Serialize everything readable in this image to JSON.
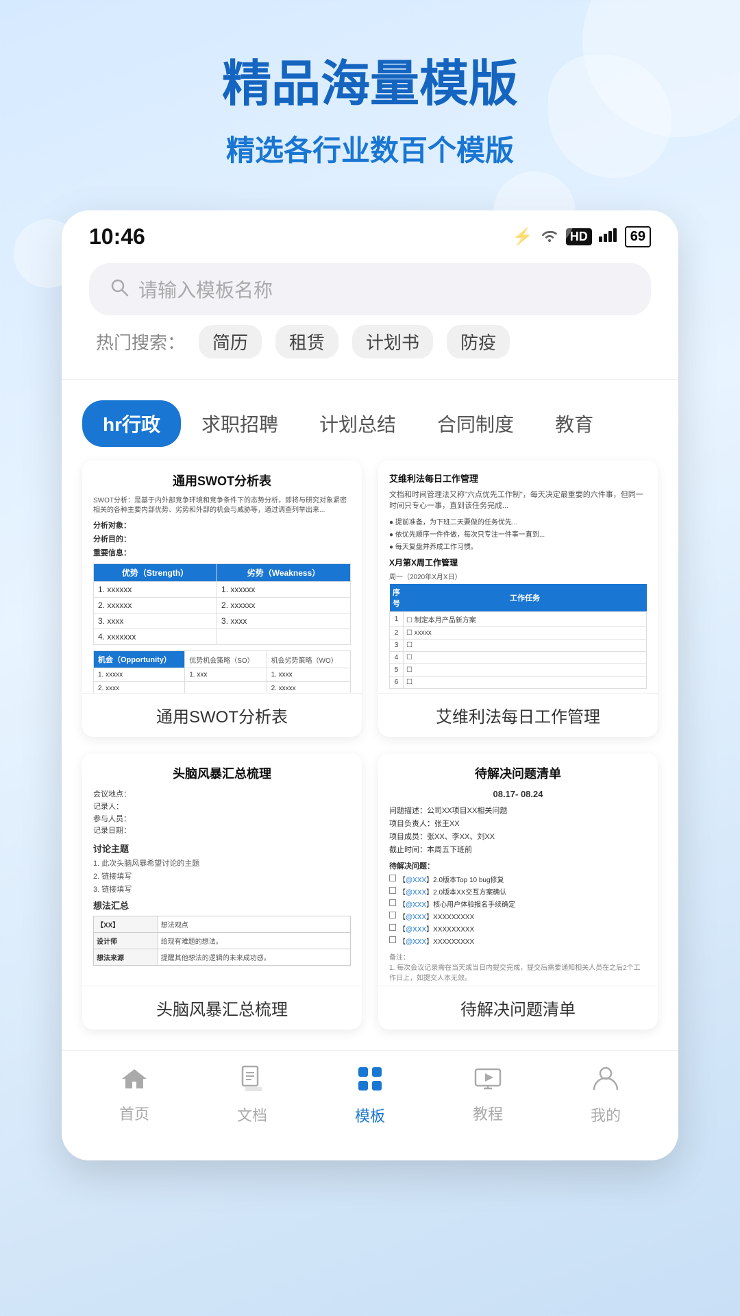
{
  "hero": {
    "title": "精品海量模版",
    "subtitle": "精选各行业数百个模版"
  },
  "statusBar": {
    "time": "10:46",
    "icons": [
      "bluetooth",
      "wifi",
      "hd",
      "signal",
      "battery"
    ],
    "batteryLevel": "69"
  },
  "search": {
    "placeholder": "请输入模板名称",
    "hotLabel": "热门搜索：",
    "hotTags": [
      "简历",
      "租赁",
      "计划书",
      "防疫"
    ]
  },
  "categories": [
    {
      "id": "hr",
      "label": "hr行政",
      "active": true
    },
    {
      "id": "job",
      "label": "求职招聘",
      "active": false
    },
    {
      "id": "plan",
      "label": "计划总结",
      "active": false
    },
    {
      "id": "contract",
      "label": "合同制度",
      "active": false
    },
    {
      "id": "edu",
      "label": "教育",
      "active": false
    }
  ],
  "templates": [
    {
      "id": "swot",
      "title": "通用SWOT分析表",
      "label": "通用SWOT分析表"
    },
    {
      "id": "workmanage",
      "title": "艾维利法每日工作管理",
      "label": "艾维利法每日工作管理"
    },
    {
      "id": "brainstorm",
      "title": "头脑风暴汇总梳理",
      "label": "头脑风暴汇总梳理"
    },
    {
      "id": "problem",
      "title": "待解决问题清单",
      "label": "待解决问题清单"
    }
  ],
  "bottomNav": [
    {
      "id": "home",
      "label": "首页",
      "icon": "🏠",
      "active": false
    },
    {
      "id": "docs",
      "label": "文档",
      "icon": "📄",
      "active": false
    },
    {
      "id": "templates",
      "label": "模板",
      "icon": "📦",
      "active": true
    },
    {
      "id": "tutorial",
      "label": "教程",
      "icon": "🖼",
      "active": false
    },
    {
      "id": "mine",
      "label": "我的",
      "icon": "👤",
      "active": false
    }
  ]
}
